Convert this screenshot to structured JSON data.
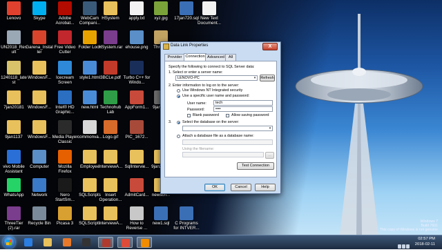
{
  "desktop_icons": [
    {
      "label": "Lenovo",
      "color": "#e0412f"
    },
    {
      "label": "Skype",
      "color": "#00aff0"
    },
    {
      "label": "Adobe Acrobat...",
      "color": "#b30b00"
    },
    {
      "label": "WebCam Compani...",
      "color": "#3a5a7a"
    },
    {
      "label": "HSystem",
      "color": "#e8c05c"
    },
    {
      "label": "apply.txt",
      "color": "#f2f2f2"
    },
    {
      "label": "xyz.jpg",
      "color": "#7aa33a"
    },
    {
      "label": "17jan720.sql",
      "color": "#3b6fb5"
    },
    {
      "label": "New Text Document...",
      "color": "#f2f2f2"
    },
    {
      "label": "UN2018_Result",
      "color": "#9aa7b5"
    },
    {
      "label": "Garena_Installer",
      "color": "#d8452c"
    },
    {
      "label": "Free Video Cutter",
      "color": "#c1272d"
    },
    {
      "label": "Folder Lock",
      "color": "#e8a200"
    },
    {
      "label": "HSystem.rar",
      "color": "#7a3c8c"
    },
    {
      "label": "ehouse.png",
      "color": "#5a8fc8"
    },
    {
      "label": "Three...",
      "color": "#c2a262"
    },
    {
      "label": "1240118_latest",
      "color": "#d8c26a"
    },
    {
      "label": "WindowsF...",
      "color": "#e8c05c"
    },
    {
      "label": "Icecream Screen",
      "color": "#2e8ad8"
    },
    {
      "label": "style1.html",
      "color": "#4a8bd8"
    },
    {
      "label": "3BCLe.pdf",
      "color": "#c23a2a"
    },
    {
      "label": "Turbo C++ for Windo...",
      "color": "#1a2e5a"
    },
    {
      "label": "7jan20181",
      "color": "#e8c05c"
    },
    {
      "label": "WindowsF...",
      "color": "#e8c05c"
    },
    {
      "label": "Intel® HD Graphic...",
      "color": "#2a6fc2"
    },
    {
      "label": "new.html",
      "color": "#4a8bd8"
    },
    {
      "label": "Technohub Lab",
      "color": "#2f9d47"
    },
    {
      "label": "AppForm1...",
      "color": "#c84a3a"
    },
    {
      "label": "9jan11...",
      "color": "#6a6a6a"
    },
    {
      "label": "9jan1137",
      "color": "#e8c05c"
    },
    {
      "label": "WindowsF...",
      "color": "#e8c05c"
    },
    {
      "label": "Media Player Classic",
      "color": "#2b2b2b"
    },
    {
      "label": "commonva...",
      "color": "#d8d8d8"
    },
    {
      "label": "Logo.gif",
      "color": "#d86a2a"
    },
    {
      "label": "PIC_1672...",
      "color": "#a84a3a"
    },
    {
      "label": "vivo Mobile Assistant",
      "color": "#2a6fd8"
    },
    {
      "label": "Computer",
      "color": "#5a8fc8"
    },
    {
      "label": "Mozilla Firefox",
      "color": "#e66000"
    },
    {
      "label": "Employee",
      "color": "#e8c05c"
    },
    {
      "label": "InterviewA...",
      "color": "#e8c05c"
    },
    {
      "label": "SqlIntervie...",
      "color": "#e8c05c"
    },
    {
      "label": "9jan201...",
      "color": "#e8c05c"
    },
    {
      "label": "WhatsApp",
      "color": "#25d366"
    },
    {
      "label": "Network",
      "color": "#3a7ac8"
    },
    {
      "label": "Nero StartSm...",
      "color": "#1a1a1a"
    },
    {
      "label": "SQLScripts",
      "color": "#e8c05c"
    },
    {
      "label": "Insert Operation...",
      "color": "#e8c05c"
    },
    {
      "label": "AdmitCard...",
      "color": "#c84a3a"
    },
    {
      "label": "newscri...",
      "color": "#e8c05c"
    },
    {
      "label": "ThreeTier (2).rar",
      "color": "#7a3c8c"
    },
    {
      "label": "Recycle Bin",
      "color": "#7a8a9a"
    },
    {
      "label": "Picasa 3",
      "color": "#d8a030"
    },
    {
      "label": "SQLScripts",
      "color": "#e8c05c"
    },
    {
      "label": "InterviewA...",
      "color": "#e8c05c"
    },
    {
      "label": "How to Reverse ...",
      "color": "#c8c8c8"
    },
    {
      "label": "new1.sql",
      "color": "#3b6fb5"
    },
    {
      "label": "C Programs for INTVER...",
      "color": "#3b6fb5"
    }
  ],
  "dialog": {
    "title": "Data Link Properties",
    "close_label": "X",
    "tabs": [
      "Provider",
      "Connection",
      "Advanced",
      "All"
    ],
    "active_tab": "Connection",
    "intro": "Specify the following to connect to SQL Server data:",
    "step1": "1. Select or enter a server name:",
    "server_name": "LENOVO-PC",
    "refresh_label": "Refresh",
    "step2": "2. Enter information to log on to the server:",
    "opt_windows_auth": "Use Windows NT Integrated security",
    "opt_sql_auth": "Use a specific user name and password:",
    "username_label": "User name:",
    "username_value": "tech",
    "password_label": "Password:",
    "password_value": "••••",
    "blank_password_label": "Blank password",
    "allow_saving_label": "Allow saving password",
    "step3_prefix": "3.",
    "opt_select_db": "Select the database on the server:",
    "database_value": "",
    "opt_attach_db": "Attach a database file as a database name:",
    "attach_db_value": "",
    "using_filename_label": "Using the filename:",
    "filename_value": "",
    "browse_label": "...",
    "test_connection_label": "Test Connection",
    "ok_label": "OK",
    "cancel_label": "Cancel",
    "help_label": "Help"
  },
  "taskbar": {
    "items": [
      {
        "name": "ie",
        "color": "#2a7de1"
      },
      {
        "name": "explorer",
        "color": "#e8c05c"
      },
      {
        "name": "media-player",
        "color": "#e8792a"
      },
      {
        "name": "clapper",
        "color": "#333333"
      },
      {
        "name": "tools",
        "color": "#b03a2e"
      },
      {
        "name": "chrome",
        "color": "#dd4b39"
      },
      {
        "name": "vlc",
        "color": "#f28c00"
      }
    ],
    "time": "02:57 PM",
    "date": "2018-02-11"
  },
  "watermark": {
    "line1": "Windows 7",
    "line2": "Build 7601",
    "line3": "This copy of Windows is not genuine"
  },
  "colors": {
    "accent": "#1c5fa8",
    "dialog_bg": "#c9dcf2",
    "taskbar": "#1c2b40"
  }
}
